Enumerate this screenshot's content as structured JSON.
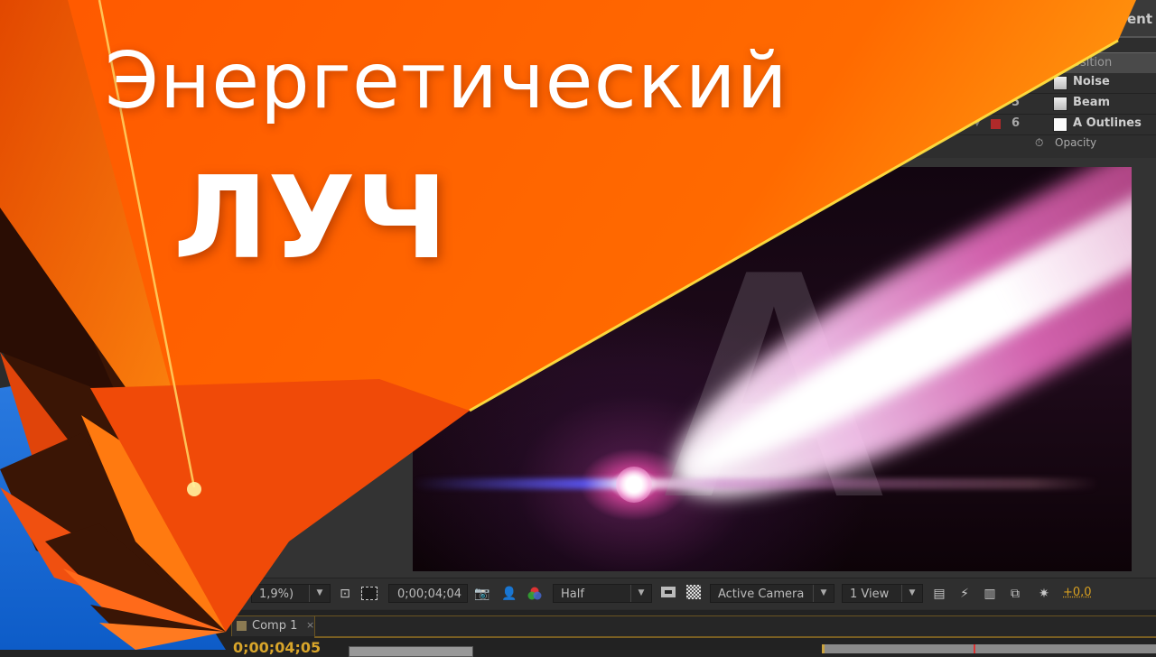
{
  "thumbnail": {
    "title_line1": "Энергетический",
    "title_line2": "луч"
  },
  "layer_panel": {
    "header_partial": "ent",
    "column_header_partial": "osition",
    "layers": [
      {
        "number": "",
        "name": "Noise",
        "color": "#ffffff"
      },
      {
        "number": "5",
        "name": "Beam",
        "color": "#b02a2a"
      },
      {
        "number": "6",
        "name": "A Outlines",
        "color": "#b02a2a"
      }
    ],
    "property": {
      "name": "Opacity",
      "icon": "stopwatch-icon"
    }
  },
  "viewer": {
    "letter": "A"
  },
  "viewer_toolbar": {
    "magnification_partial": "1,9%)",
    "current_time": "0;00;04;04",
    "resolution": "Half",
    "camera": "Active Camera",
    "views": "1 View",
    "exposure": "+0,0",
    "icons": [
      "region-of-interest-icon",
      "transparency-grid-icon",
      "snapshot-camera-icon",
      "show-snapshot-icon",
      "rgb-channels-icon",
      "toggle-mask-icon",
      "checkerboard-icon",
      "layout-icon",
      "fast-previews-icon",
      "timeline-icon",
      "flowchart-icon",
      "reset-exposure-icon"
    ]
  },
  "timeline": {
    "tab_label": "Comp 1",
    "tab_close": "×",
    "timecode": "0;00;04;05"
  },
  "colors": {
    "accent_orange": "#ff6000",
    "timecode_gold": "#d8a52a",
    "ui_dark": "#2b2b2b"
  }
}
